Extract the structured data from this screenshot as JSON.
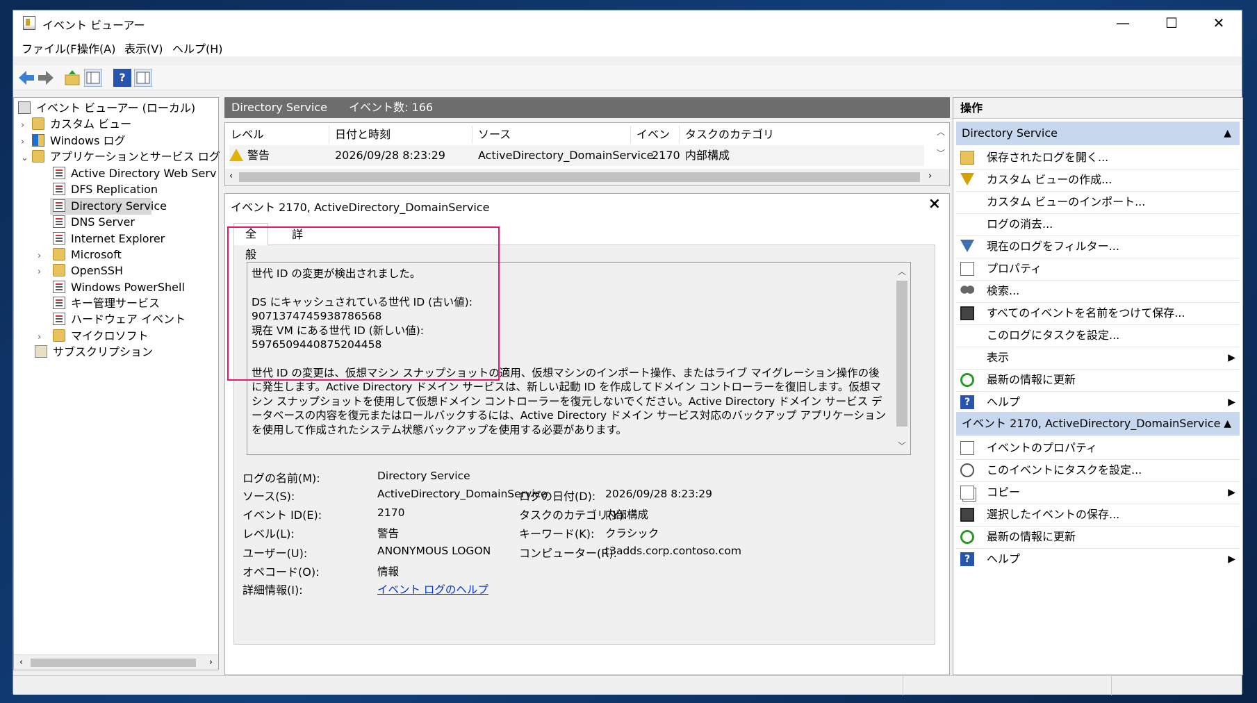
{
  "window": {
    "title": "イベント ビューアー",
    "controls": {
      "minimize": "—",
      "maximize": "☐",
      "close": "✕"
    }
  },
  "menu": [
    "ファイル(F)",
    "操作(A)",
    "表示(V)",
    "ヘルプ(H)"
  ],
  "toolbar": {
    "back": "back-arrow-icon",
    "forward": "forward-arrow-icon",
    "help": "?"
  },
  "tree": {
    "root": "イベント ビューアー (ローカル)",
    "items": [
      {
        "label": "カスタム ビュー",
        "level": 1
      },
      {
        "label": "Windows ログ",
        "level": 1
      },
      {
        "label": "アプリケーションとサービス ログ",
        "level": 1
      },
      {
        "label": "Active Directory Web Serv",
        "level": 2
      },
      {
        "label": "DFS Replication",
        "level": 2
      },
      {
        "label": "Directory Service",
        "level": 2
      },
      {
        "label": "DNS Server",
        "level": 2
      },
      {
        "label": "Internet Explorer",
        "level": 2
      },
      {
        "label": "Microsoft",
        "level": 2
      },
      {
        "label": "OpenSSH",
        "level": 2
      },
      {
        "label": "Windows PowerShell",
        "level": 2
      },
      {
        "label": "キー管理サービス",
        "level": 2
      },
      {
        "label": "ハードウェア イベント",
        "level": 2
      },
      {
        "label": "マイクロソフト",
        "level": 2
      },
      {
        "label": "サブスクリプション",
        "level": 0
      }
    ]
  },
  "center": {
    "header_title": "Directory Service",
    "header_count": "イベント数: 166",
    "columns": [
      "レベル",
      "日付と時刻",
      "ソース",
      "イベント...",
      "タスクのカテゴリ"
    ],
    "row": {
      "level": "警告",
      "datetime": "2026/09/28 8:23:29",
      "source": "ActiveDirectory_DomainService",
      "event_id": "2170",
      "category": "内部構成"
    },
    "detail_title": "イベント 2170, ActiveDirectory_DomainService",
    "tabs": [
      "全般",
      "詳細"
    ],
    "description": [
      "世代 ID の変更が検出されました。",
      "",
      "DS にキャッシュされている世代 ID (古い値):",
      "9071374745938786568",
      "現在 VM にある世代 ID (新しい値):",
      "5976509440875204458",
      "",
      "世代 ID の変更は、仮想マシン スナップショットの適用、仮想マシンのインポート操作、またはライブ マイグレーション操作の後に発生します。Active Directory ドメイン サービスは、新しい起動 ID を作成してドメイン コントローラーを復旧します。仮想マシン スナップショットを使用して仮想ドメイン コントローラーを復元しないでください。Active Directory ドメイン サービス データベースの内容を復元またはロールバックするには、Active Directory ドメイン サービス対応のバックアップ アプリケーションを使用して作成されたシステム状態バックアップを使用する必要があります。"
    ],
    "props": {
      "log_name_label": "ログの名前(M):",
      "log_name": "Directory Service",
      "source_label": "ソース(S):",
      "source": "ActiveDirectory_DomainService",
      "logged_label": "ログの日付(D):",
      "logged": "2026/09/28 8:23:29",
      "event_id_label": "イベント ID(E):",
      "event_id": "2170",
      "category_label": "タスクのカテゴリ(Y):",
      "category": "内部構成",
      "level_label": "レベル(L):",
      "level": "警告",
      "keywords_label": "キーワード(K):",
      "keywords": "クラシック",
      "user_label": "ユーザー(U):",
      "user": "ANONYMOUS LOGON",
      "computer_label": "コンピューター(R):",
      "computer": "t3adds.corp.contoso.com",
      "opcode_label": "オペコード(O):",
      "opcode": "情報",
      "more_label": "詳細情報(I):",
      "more_link": "イベント ログのヘルプ"
    }
  },
  "actions": {
    "title": "操作",
    "section1": "Directory Service",
    "items1": [
      {
        "label": "保存されたログを開く...",
        "icon": "open-log-icon"
      },
      {
        "label": "カスタム ビューの作成...",
        "icon": "custom-view-icon"
      },
      {
        "label": "カスタム ビューのインポート...",
        "icon": ""
      },
      {
        "label": "ログの消去...",
        "icon": ""
      },
      {
        "label": "現在のログをフィルター...",
        "icon": "filter-icon"
      },
      {
        "label": "プロパティ",
        "icon": "properties-icon"
      },
      {
        "label": "検索...",
        "icon": "find-icon"
      },
      {
        "label": "すべてのイベントを名前をつけて保存...",
        "icon": "save-icon"
      },
      {
        "label": "このログにタスクを設定...",
        "icon": ""
      },
      {
        "label": "表示",
        "icon": ""
      },
      {
        "label": "最新の情報に更新",
        "icon": "refresh-icon"
      },
      {
        "label": "ヘルプ",
        "icon": "help-icon"
      }
    ],
    "section2": "イベント 2170, ActiveDirectory_DomainService",
    "items2": [
      {
        "label": "イベントのプロパティ",
        "icon": "event-properties-icon"
      },
      {
        "label": "このイベントにタスクを設定...",
        "icon": "task-icon"
      },
      {
        "label": "コピー",
        "icon": "copy-icon"
      },
      {
        "label": "選択したイベントの保存...",
        "icon": "save-icon"
      },
      {
        "label": "最新の情報に更新",
        "icon": "refresh-icon"
      },
      {
        "label": "ヘルプ",
        "icon": "help-icon"
      }
    ]
  },
  "colors": {
    "highlight": "#e8166f",
    "section_header": "#c6d7ee",
    "link": "#0033cc"
  }
}
